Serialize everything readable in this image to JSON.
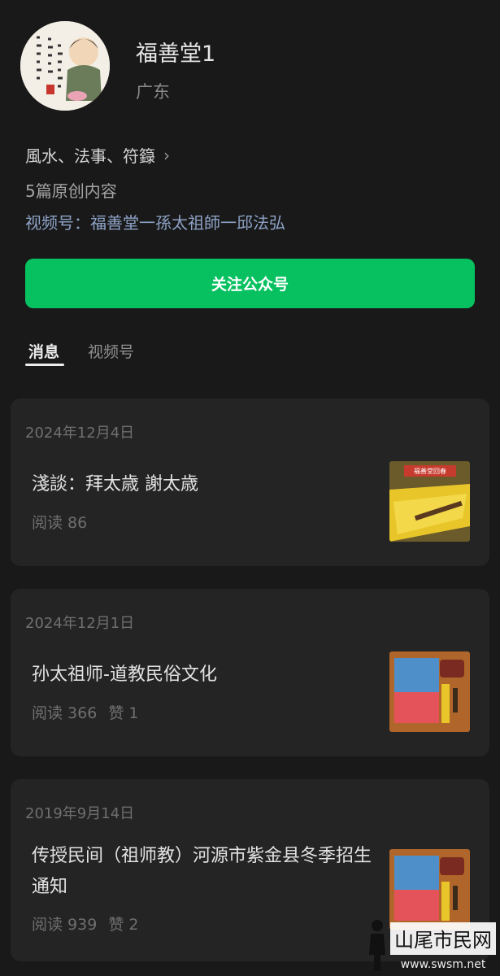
{
  "profile": {
    "name": "福善堂1",
    "region": "广东",
    "services": "風水、法事、符籙",
    "original_count": "5篇原创内容",
    "channel_link": "视频号：福善堂一孫太祖師一邱法弘",
    "follow_button": "关注公众号"
  },
  "tabs": [
    {
      "label": "消息",
      "active": true
    },
    {
      "label": "视频号",
      "active": false
    }
  ],
  "articles": [
    {
      "date": "2024年12月4日",
      "title": "淺談：拜太歳 謝太歳",
      "reads": "阅读 86",
      "likes": "",
      "thumb_banner": "福善堂回春"
    },
    {
      "date": "2024年12月1日",
      "title": "孙太祖师-道教民俗文化",
      "reads": "阅读 366",
      "likes": "赞 1"
    },
    {
      "date": "2019年9月14日",
      "title": "传授民间（祖师教）河源市紫金县冬季招生通知",
      "reads": "阅读 939",
      "likes": "赞 2"
    }
  ],
  "watermark": {
    "text": "山尾市民网",
    "url": "www.swsm.net"
  },
  "colors": {
    "accent": "#07c160",
    "link": "#8ea3c7",
    "background": "#191919",
    "card": "#242424"
  }
}
